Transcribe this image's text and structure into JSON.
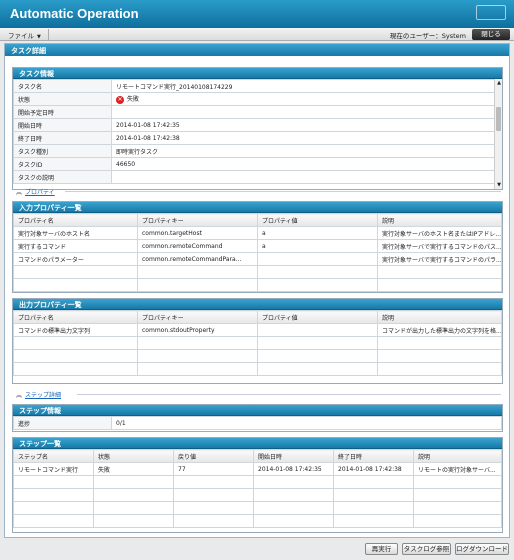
{
  "app": {
    "title": "Automatic Operation"
  },
  "menu": {
    "file": "ファイル",
    "user_label": "現在のユーザー：System",
    "close": "閉じる"
  },
  "main": {
    "title": "タスク詳細"
  },
  "task_info": {
    "title": "タスク情報",
    "rows": [
      {
        "key": "タスク名",
        "value": "リモートコマンド実行_20140108174229"
      },
      {
        "key": "状態",
        "value": "失敗"
      },
      {
        "key": "開始予定日時",
        "value": ""
      },
      {
        "key": "開始日時",
        "value": "2014-01-08 17:42:35"
      },
      {
        "key": "終了日時",
        "value": "2014-01-08 17:42:38"
      },
      {
        "key": "タスク種別",
        "value": "即時実行タスク"
      },
      {
        "key": "タスクID",
        "value": "46650"
      },
      {
        "key": "タスクの説明",
        "value": ""
      }
    ]
  },
  "toggles": {
    "property": "プロパティ",
    "step_detail": "ステップ詳細"
  },
  "input_props": {
    "title": "入力プロパティ一覧",
    "headers": [
      "プロパティ名",
      "プロパティキー",
      "プロパティ値",
      "説明"
    ],
    "rows": [
      [
        "実行対象サーバのホスト名",
        "common.targetHost",
        "a",
        "実行対象サーバのホスト名またはIPアドレ..."
      ],
      [
        "実行するコマンド",
        "common.remoteCommand",
        "a",
        "実行対象サーバで実行するコマンドのパス..."
      ],
      [
        "コマンドのパラメーター",
        "common.remoteCommandPara...",
        "",
        "実行対象サーバで実行するコマンドのパラ..."
      ]
    ]
  },
  "output_props": {
    "title": "出力プロパティ一覧",
    "headers": [
      "プロパティ名",
      "プロパティキー",
      "プロパティ値",
      "説明"
    ],
    "rows": [
      [
        "コマンドの標準出力文字列",
        "common.stdoutProperty",
        "",
        "コマンドが出力した標準出力の文字列を格..."
      ]
    ]
  },
  "step_info": {
    "title": "ステップ情報",
    "rows": [
      {
        "key": "進捗",
        "value": "0/1"
      }
    ]
  },
  "step_list": {
    "title": "ステップ一覧",
    "headers": [
      "ステップ名",
      "状態",
      "戻り値",
      "開始日時",
      "終了日時",
      "説明"
    ],
    "rows": [
      [
        "リモートコマンド実行",
        "失敗",
        "77",
        "2014-01-08 17:42:35",
        "2014-01-08 17:42:38",
        "リモートの実行対象サーバ..."
      ]
    ]
  },
  "buttons": {
    "rerun": "再実行",
    "task_log": "タスクログ参照",
    "log_download": "ログダウンロード"
  },
  "colors": {
    "header_blue": "#1679a8",
    "fail_red": "#dd2222",
    "link_blue": "#1565b8"
  }
}
